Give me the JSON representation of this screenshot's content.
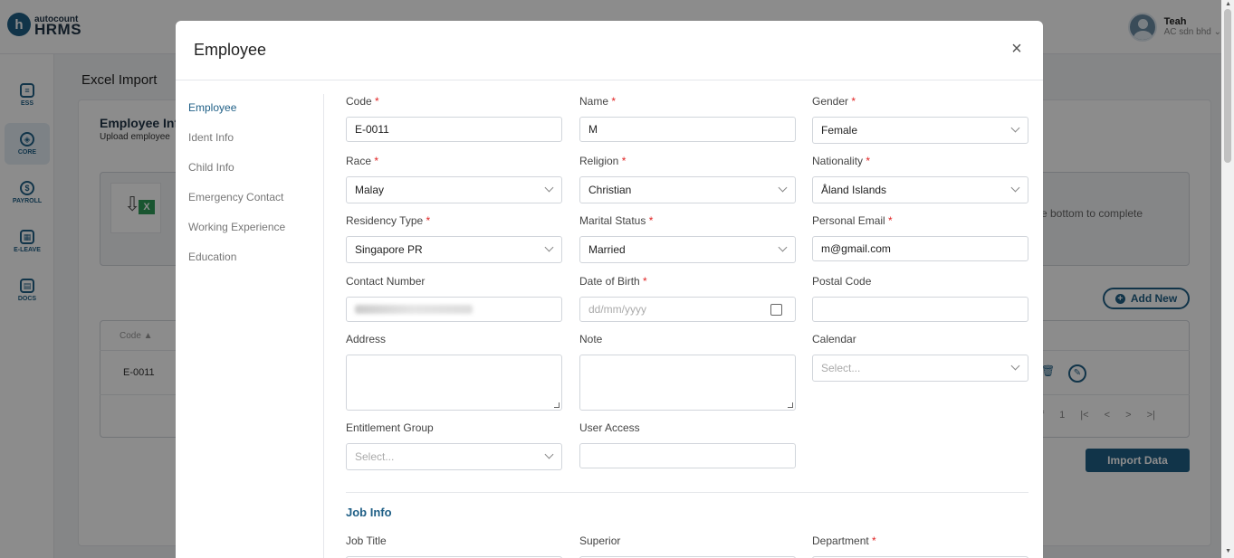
{
  "app": {
    "logo_small": "autocount",
    "logo_big": "HRMS",
    "user_name": "Teah",
    "company": "AC sdn bhd"
  },
  "sidenav": [
    {
      "label": "ESS",
      "icon": "ess-icon"
    },
    {
      "label": "CORE",
      "icon": "core-icon"
    },
    {
      "label": "PAYROLL",
      "icon": "payroll-icon"
    },
    {
      "label": "E-LEAVE",
      "icon": "calendar-icon"
    },
    {
      "label": "DOCS",
      "icon": "docs-icon"
    }
  ],
  "background": {
    "page_title": "Excel Import",
    "panel_title": "Employee Inf",
    "panel_sub": "Upload employee",
    "upload_text": "e bottom to complete",
    "add_new": "Add New",
    "th_code": "Code ▲",
    "row_code": "E-0011",
    "pager": "f 1 |< < > >|",
    "import_data": "Import Data"
  },
  "modal": {
    "title": "Employee",
    "close": "×",
    "tabs": [
      "Employee",
      "Ident Info",
      "Child Info",
      "Emergency Contact",
      "Working Experience",
      "Education"
    ],
    "fields": {
      "code": {
        "label": "Code",
        "value": "E-0011"
      },
      "name": {
        "label": "Name",
        "value": "M"
      },
      "gender": {
        "label": "Gender",
        "value": "Female"
      },
      "race": {
        "label": "Race",
        "value": "Malay"
      },
      "religion": {
        "label": "Religion",
        "value": "Christian"
      },
      "nationality": {
        "label": "Nationality",
        "value": "Åland Islands"
      },
      "residency": {
        "label": "Residency Type",
        "value": "Singapore PR"
      },
      "marital": {
        "label": "Marital Status",
        "value": "Married"
      },
      "email": {
        "label": "Personal Email",
        "value": "m@gmail.com"
      },
      "contact": {
        "label": "Contact Number"
      },
      "dob": {
        "label": "Date of Birth",
        "placeholder": "dd/mm/yyyy"
      },
      "postal": {
        "label": "Postal Code"
      },
      "address": {
        "label": "Address"
      },
      "note": {
        "label": "Note"
      },
      "calendar": {
        "label": "Calendar",
        "placeholder": "Select..."
      },
      "entitlement": {
        "label": "Entitlement Group",
        "placeholder": "Select..."
      },
      "user_access": {
        "label": "User Access"
      },
      "job_title": {
        "label": "Job Title"
      },
      "superior": {
        "label": "Superior"
      },
      "department": {
        "label": "Department"
      }
    },
    "job_info_title": "Job Info",
    "required_mark": "*"
  }
}
